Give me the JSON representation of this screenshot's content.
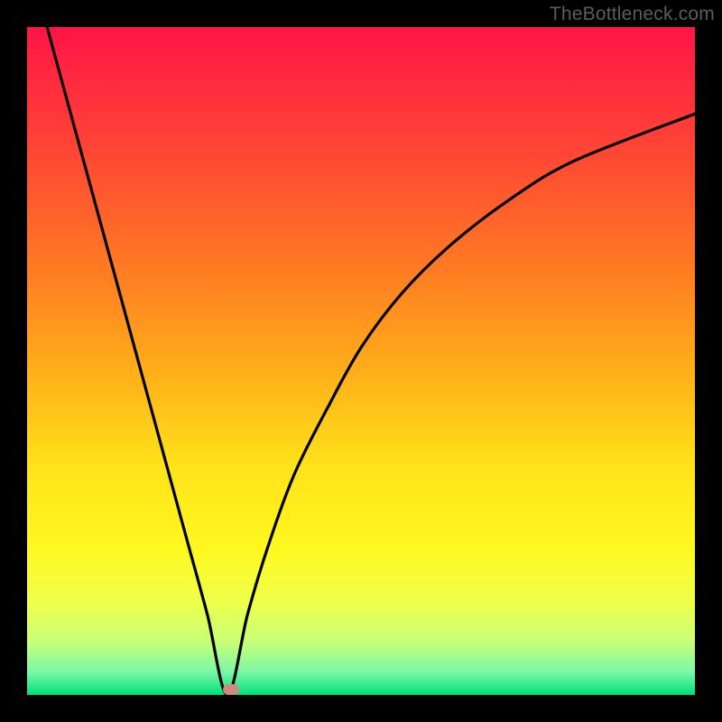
{
  "watermark": "TheBottleneck.com",
  "colors": {
    "page_bg": "#000000",
    "watermark_text": "#5c5c5c",
    "curve_stroke": "#000000",
    "marker_fill": "#cf8a7b",
    "gradient_stops": [
      {
        "offset": 0.0,
        "color": "#ff1547"
      },
      {
        "offset": 0.18,
        "color": "#ff4435"
      },
      {
        "offset": 0.36,
        "color": "#ff7a22"
      },
      {
        "offset": 0.52,
        "color": "#ffb019"
      },
      {
        "offset": 0.66,
        "color": "#ffe31a"
      },
      {
        "offset": 0.78,
        "color": "#fff81e"
      },
      {
        "offset": 0.86,
        "color": "#f0ff4a"
      },
      {
        "offset": 0.92,
        "color": "#c8ff76"
      },
      {
        "offset": 0.965,
        "color": "#7cf9a6"
      },
      {
        "offset": 1.0,
        "color": "#00e07a"
      }
    ]
  },
  "chart_data": {
    "type": "line",
    "title": "",
    "xlabel": "",
    "ylabel": "",
    "xlim": [
      0,
      100
    ],
    "ylim": [
      0,
      100
    ],
    "grid": false,
    "legend": false,
    "min_point": {
      "x": 30,
      "y": 0
    },
    "series": [
      {
        "name": "left-branch",
        "x": [
          3,
          6,
          9,
          12,
          15,
          18,
          21,
          24,
          27,
          30
        ],
        "y": [
          100,
          89,
          78,
          67,
          56,
          45,
          34,
          23,
          12,
          0
        ]
      },
      {
        "name": "right-branch",
        "x": [
          30,
          33,
          36,
          40,
          45,
          50,
          56,
          63,
          72,
          82,
          100
        ],
        "y": [
          0,
          12,
          22,
          33,
          43,
          52,
          60,
          67,
          74,
          80,
          87
        ]
      }
    ],
    "marker": {
      "x": 30.5,
      "y": 0.8
    }
  }
}
